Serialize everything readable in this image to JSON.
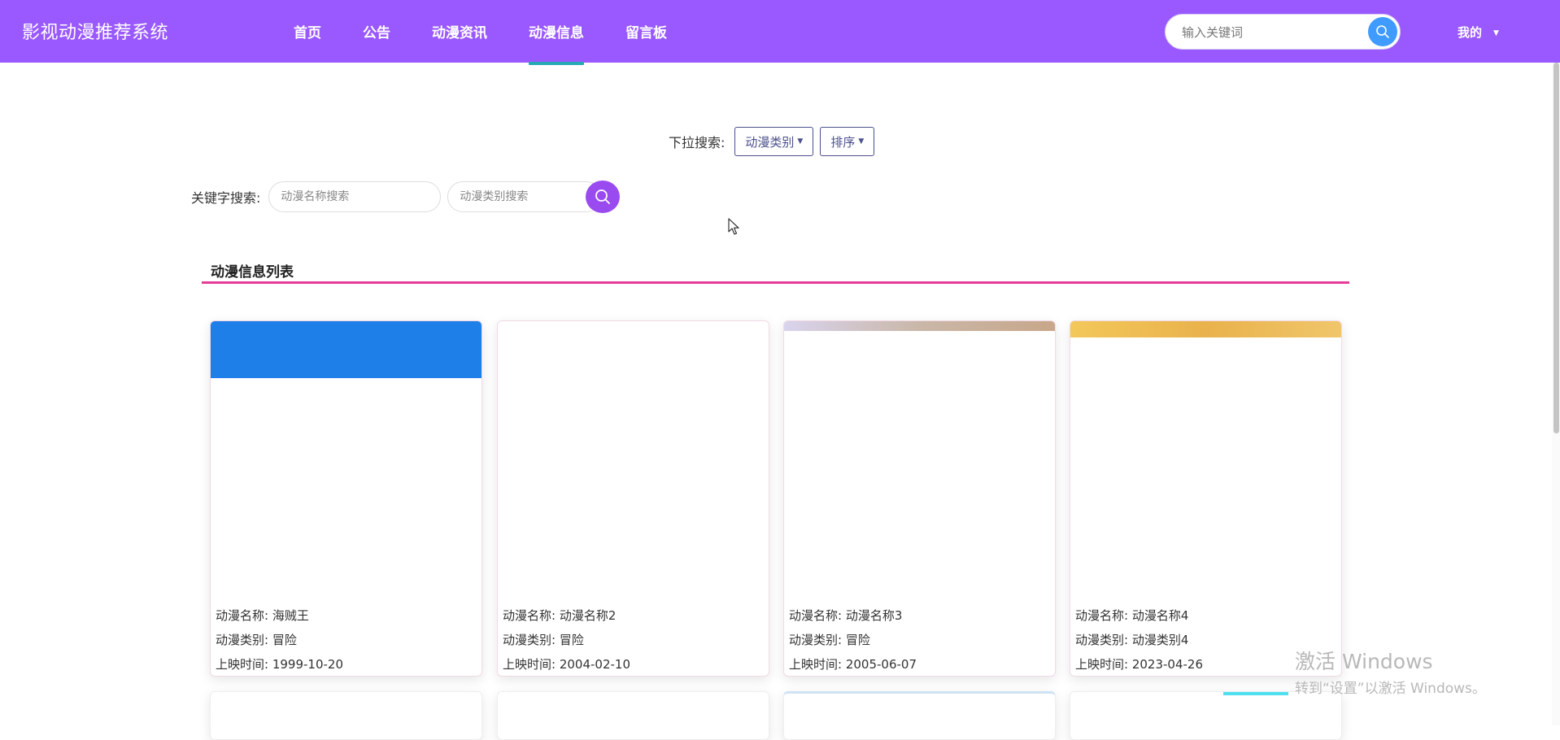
{
  "header": {
    "brand": "影视动漫推荐系统",
    "nav": [
      {
        "label": "首页"
      },
      {
        "label": "公告"
      },
      {
        "label": "动漫资讯"
      },
      {
        "label": "动漫信息",
        "active": true
      },
      {
        "label": "留言板"
      }
    ],
    "search_placeholder": "输入关键词",
    "user_menu": "我的"
  },
  "filters": {
    "dropdown_label": "下拉搜索:",
    "category_button": "动漫类别",
    "sort_button": "排序",
    "keyword_label": "关键字搜索:",
    "name_placeholder": "动漫名称搜索",
    "category_placeholder": "动漫类别搜索"
  },
  "section": {
    "title": "动漫信息列表"
  },
  "cards": [
    {
      "name_label": "动漫名称:",
      "name": "海贼王",
      "type_label": "动漫类别:",
      "type": "冒险",
      "date_label": "上映时间:",
      "date": "1999-10-20"
    },
    {
      "name_label": "动漫名称:",
      "name": "动漫名称2",
      "type_label": "动漫类别:",
      "type": "冒险",
      "date_label": "上映时间:",
      "date": "2004-02-10"
    },
    {
      "name_label": "动漫名称:",
      "name": "动漫名称3",
      "type_label": "动漫类别:",
      "type": "冒险",
      "date_label": "上映时间:",
      "date": "2005-06-07"
    },
    {
      "name_label": "动漫名称:",
      "name": "动漫名称4",
      "type_label": "动漫类别:",
      "type": "动漫类别4",
      "date_label": "上映时间:",
      "date": "2023-04-26"
    }
  ],
  "watermark": {
    "line1": "激活 Windows",
    "line2": "转到“设置”以激活 Windows。"
  },
  "colors": {
    "header_bg": "#9a59ff",
    "active_underline": "#27a9b5",
    "section_line": "#e53c9a",
    "search_button": "#3f9bff",
    "keyword_button": "#9a4bf0"
  }
}
